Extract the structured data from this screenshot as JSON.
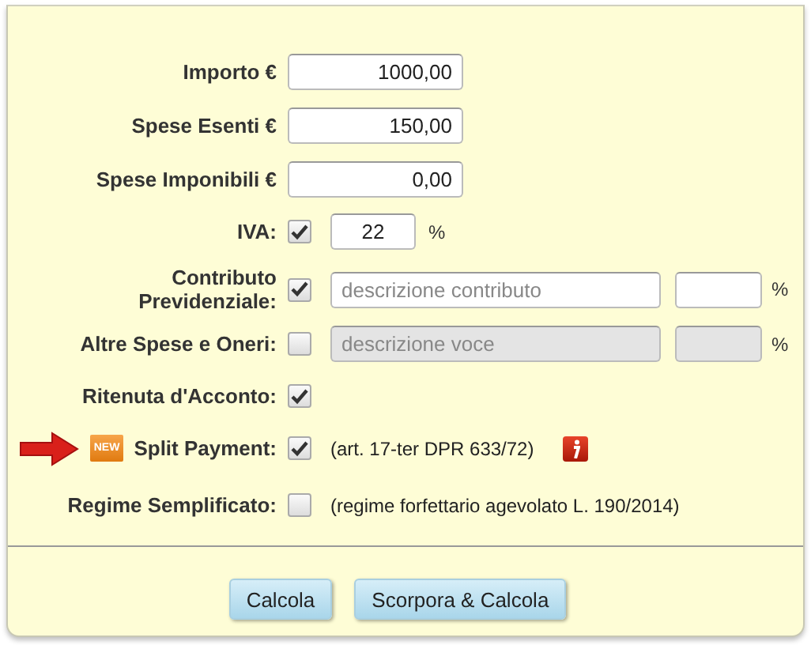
{
  "rows": [
    {
      "kind": "amount",
      "label": "Importo €",
      "value": "1000,00"
    },
    {
      "kind": "amount",
      "label": "Spese Esenti €",
      "value": "150,00"
    },
    {
      "kind": "amount",
      "label": "Spese Imponibili €",
      "value": "0,00"
    },
    {
      "kind": "percent",
      "label": "IVA:",
      "checked": true,
      "value": "22",
      "unit": "%"
    },
    {
      "kind": "expense",
      "label": "Contributo Previdenziale:",
      "checked": true,
      "disabled": false,
      "placeholder": "descrizione contributo",
      "unit": "%"
    },
    {
      "kind": "expense",
      "label": "Altre Spese e Oneri:",
      "checked": false,
      "disabled": true,
      "placeholder": "descrizione voce",
      "unit": "%"
    },
    {
      "kind": "check",
      "label": "Ritenuta d'Acconto:",
      "checked": true
    },
    {
      "kind": "note",
      "label": "Split Payment:",
      "badge": "NEW",
      "pointed": true,
      "checked": true,
      "note": "(art. 17-ter DPR 633/72)",
      "info": true
    },
    {
      "kind": "note",
      "label": "Regime Semplificato:",
      "checked": false,
      "note": "(regime forfettario agevolato L. 190/2014)"
    }
  ],
  "buttons": [
    "Calcola",
    "Scorpora & Calcola"
  ]
}
